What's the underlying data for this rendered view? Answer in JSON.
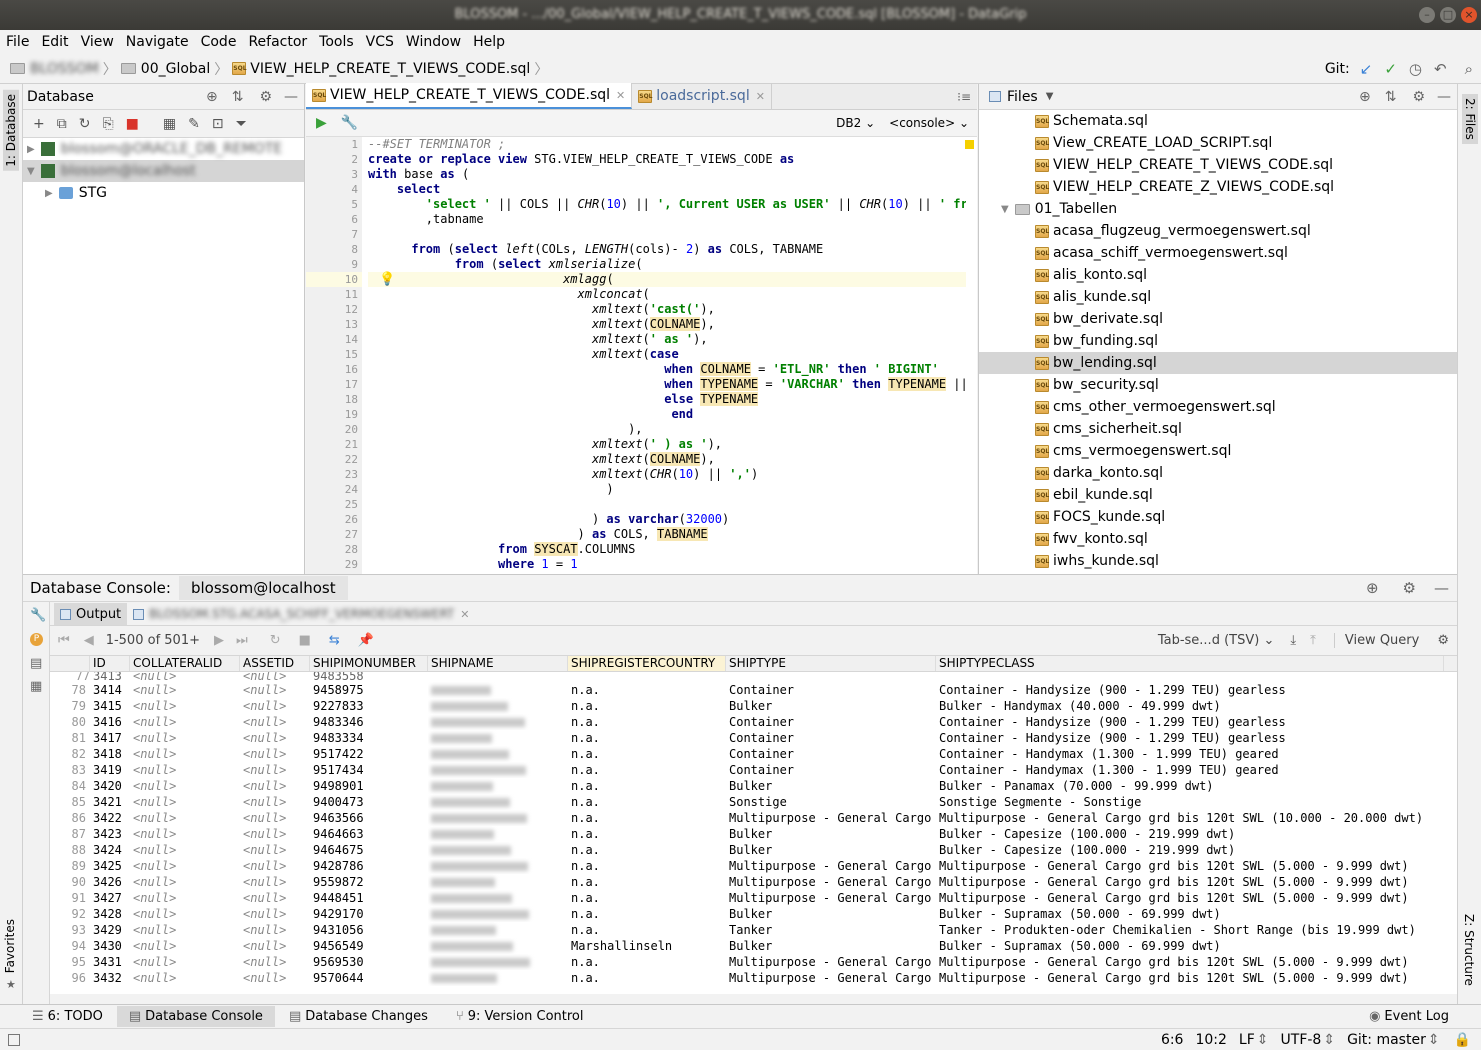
{
  "window": {
    "title": "BLOSSOM - .../00_Global/VIEW_HELP_CREATE_T_VIEWS_CODE.sql [BLOSSOM] - DataGrip"
  },
  "menu": [
    "File",
    "Edit",
    "View",
    "Navigate",
    "Code",
    "Refactor",
    "Tools",
    "VCS",
    "Window",
    "Help"
  ],
  "breadcrumb": {
    "project": "BLOSSOM",
    "folder": "00_Global",
    "file": "VIEW_HELP_CREATE_T_VIEWS_CODE.sql"
  },
  "git_label": "Git:",
  "left_tabs": {
    "database": "1: Database",
    "favorites": "Favorites"
  },
  "right_tabs": {
    "files": "2: Files",
    "structure": "Z: Structure"
  },
  "database_panel": {
    "title": "Database",
    "tree": [
      {
        "label": "blossom@ORACLE_DB_REMOTE",
        "blurred": true
      },
      {
        "label": "blossom@localhost",
        "blurred": true
      },
      {
        "label": "STG",
        "blurred": false
      }
    ]
  },
  "editor": {
    "tabs": [
      {
        "label": "VIEW_HELP_CREATE_T_VIEWS_CODE.sql",
        "active": true
      },
      {
        "label": "loadscript.sql",
        "active": false
      }
    ],
    "dialect": "DB2",
    "console": "<console>",
    "line_numbers": [
      "1",
      "2",
      "3",
      "4",
      "5",
      "6",
      "7",
      "8",
      "9",
      "10",
      "11",
      "12",
      "13",
      "14",
      "15",
      "16",
      "17",
      "18",
      "19",
      "20",
      "21",
      "22",
      "23",
      "24",
      "25",
      "26",
      "27",
      "28",
      "29"
    ]
  },
  "files_panel": {
    "title": "Files",
    "items": [
      {
        "label": "Schemata.sql",
        "type": "sql",
        "indent": 2
      },
      {
        "label": "View_CREATE_LOAD_SCRIPT.sql",
        "type": "sql",
        "indent": 2
      },
      {
        "label": "VIEW_HELP_CREATE_T_VIEWS_CODE.sql",
        "type": "sql",
        "indent": 2
      },
      {
        "label": "VIEW_HELP_CREATE_Z_VIEWS_CODE.sql",
        "type": "sql",
        "indent": 2
      },
      {
        "label": "01_Tabellen",
        "type": "folder",
        "indent": 1
      },
      {
        "label": "acasa_flugzeug_vermoegenswert.sql",
        "type": "sql",
        "indent": 2
      },
      {
        "label": "acasa_schiff_vermoegenswert.sql",
        "type": "sql",
        "indent": 2
      },
      {
        "label": "alis_konto.sql",
        "type": "sql",
        "indent": 2
      },
      {
        "label": "alis_kunde.sql",
        "type": "sql",
        "indent": 2
      },
      {
        "label": "bw_derivate.sql",
        "type": "sql",
        "indent": 2
      },
      {
        "label": "bw_funding.sql",
        "type": "sql",
        "indent": 2
      },
      {
        "label": "bw_lending.sql",
        "type": "sql",
        "indent": 2,
        "selected": true
      },
      {
        "label": "bw_security.sql",
        "type": "sql",
        "indent": 2
      },
      {
        "label": "cms_other_vermoegenswert.sql",
        "type": "sql",
        "indent": 2
      },
      {
        "label": "cms_sicherheit.sql",
        "type": "sql",
        "indent": 2
      },
      {
        "label": "cms_vermoegenswert.sql",
        "type": "sql",
        "indent": 2
      },
      {
        "label": "darka_konto.sql",
        "type": "sql",
        "indent": 2
      },
      {
        "label": "ebil_kunde.sql",
        "type": "sql",
        "indent": 2
      },
      {
        "label": "FOCS_kunde.sql",
        "type": "sql",
        "indent": 2
      },
      {
        "label": "fwv_konto.sql",
        "type": "sql",
        "indent": 2
      },
      {
        "label": "iwhs_kunde.sql",
        "type": "sql",
        "indent": 2
      }
    ]
  },
  "console": {
    "label": "Database Console:",
    "connection": "blossom@localhost",
    "output_tab": "Output",
    "result_tab": "BLOSSOM.STG.ACASA_SCHIFF_VERMOEGENSWERT",
    "pager": "1-500 of 501+",
    "export_format": "Tab-se...d (TSV)",
    "view_query": "View Query",
    "columns": [
      "ID",
      "COLLATERALID",
      "ASSETID",
      "SHIPIMONUMBER",
      "SHIPNAME",
      "SHIPREGISTERCOUNTRY",
      "SHIPTYPE",
      "SHIPTYPECLASS"
    ],
    "null_text": "<null>",
    "rows": [
      {
        "n": "78",
        "id": "3414",
        "imo": "9458975",
        "reg": "n.a.",
        "type": "Container",
        "cls": "Container - Handysize (900 - 1.299 TEU) gearless"
      },
      {
        "n": "79",
        "id": "3415",
        "imo": "9227833",
        "reg": "n.a.",
        "type": "Bulker",
        "cls": "Bulker - Handymax (40.000 - 49.999 dwt)"
      },
      {
        "n": "80",
        "id": "3416",
        "imo": "9483346",
        "reg": "n.a.",
        "type": "Container",
        "cls": "Container - Handysize (900 - 1.299 TEU) gearless"
      },
      {
        "n": "81",
        "id": "3417",
        "imo": "9483334",
        "reg": "n.a.",
        "type": "Container",
        "cls": "Container - Handysize (900 - 1.299 TEU) gearless"
      },
      {
        "n": "82",
        "id": "3418",
        "imo": "9517422",
        "reg": "n.a.",
        "type": "Container",
        "cls": "Container - Handymax (1.300 - 1.999 TEU) geared"
      },
      {
        "n": "83",
        "id": "3419",
        "imo": "9517434",
        "reg": "n.a.",
        "type": "Container",
        "cls": "Container - Handymax (1.300 - 1.999 TEU) geared"
      },
      {
        "n": "84",
        "id": "3420",
        "imo": "9498901",
        "reg": "n.a.",
        "type": "Bulker",
        "cls": "Bulker - Panamax (70.000 - 99.999 dwt)"
      },
      {
        "n": "85",
        "id": "3421",
        "imo": "9400473",
        "reg": "n.a.",
        "type": "Sonstige",
        "cls": "Sonstige Segmente - Sonstige"
      },
      {
        "n": "86",
        "id": "3422",
        "imo": "9463566",
        "reg": "n.a.",
        "type": "Multipurpose - General Cargo",
        "cls": "Multipurpose - General Cargo grd bis 120t SWL (10.000 - 20.000 dwt)"
      },
      {
        "n": "87",
        "id": "3423",
        "imo": "9464663",
        "reg": "n.a.",
        "type": "Bulker",
        "cls": "Bulker - Capesize (100.000 - 219.999 dwt)"
      },
      {
        "n": "88",
        "id": "3424",
        "imo": "9464675",
        "reg": "n.a.",
        "type": "Bulker",
        "cls": "Bulker - Capesize (100.000 - 219.999 dwt)"
      },
      {
        "n": "89",
        "id": "3425",
        "imo": "9428786",
        "reg": "n.a.",
        "type": "Multipurpose - General Cargo",
        "cls": "Multipurpose - General Cargo grd bis 120t SWL (5.000 - 9.999 dwt)"
      },
      {
        "n": "90",
        "id": "3426",
        "imo": "9559872",
        "reg": "n.a.",
        "type": "Multipurpose - General Cargo",
        "cls": "Multipurpose - General Cargo grd bis 120t SWL (5.000 - 9.999 dwt)"
      },
      {
        "n": "91",
        "id": "3427",
        "imo": "9448451",
        "reg": "n.a.",
        "type": "Multipurpose - General Cargo",
        "cls": "Multipurpose - General Cargo grd bis 120t SWL (5.000 - 9.999 dwt)"
      },
      {
        "n": "92",
        "id": "3428",
        "imo": "9429170",
        "reg": "n.a.",
        "type": "Bulker",
        "cls": "Bulker - Supramax (50.000 - 69.999 dwt)"
      },
      {
        "n": "93",
        "id": "3429",
        "imo": "9431056",
        "reg": "n.a.",
        "type": "Tanker",
        "cls": "Tanker - Produkten-oder Chemikalien - Short Range (bis 19.999 dwt)"
      },
      {
        "n": "94",
        "id": "3430",
        "imo": "9456549",
        "reg": "Marshallinseln",
        "type": "Bulker",
        "cls": "Bulker - Supramax (50.000 - 69.999 dwt)"
      },
      {
        "n": "95",
        "id": "3431",
        "imo": "9569530",
        "reg": "n.a.",
        "type": "Multipurpose - General Cargo",
        "cls": "Multipurpose - General Cargo grd bis 120t SWL (5.000 - 9.999 dwt)"
      },
      {
        "n": "96",
        "id": "3432",
        "imo": "9570644",
        "reg": "n.a.",
        "type": "Multipurpose - General Cargo",
        "cls": "Multipurpose - General Cargo grd bis 120t SWL (5.000 - 9.999 dwt)"
      }
    ]
  },
  "bottom_tabs": [
    "6: TODO",
    "Database Console",
    "Database Changes",
    "9: Version Control"
  ],
  "event_log": "Event Log",
  "status": {
    "position": "6:6",
    "selection": "10:2",
    "line_sep": "LF",
    "encoding": "UTF-8",
    "branch": "Git: master"
  }
}
